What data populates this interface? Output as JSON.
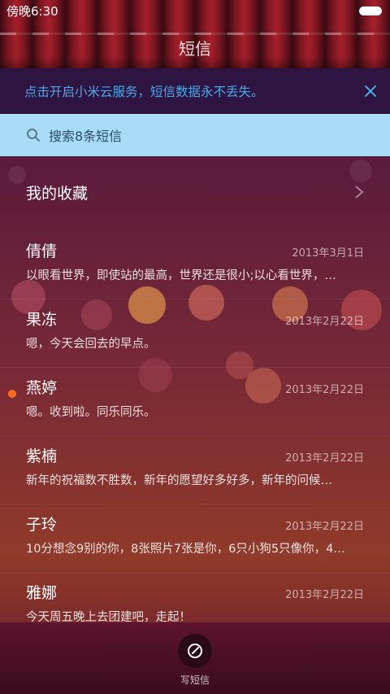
{
  "status_bar": {
    "time": "傍晚6:30"
  },
  "header": {
    "title": "短信"
  },
  "banner": {
    "text": "点击开启小米云服务，短信数据永不丢失。"
  },
  "search": {
    "placeholder": "搜索8条短信"
  },
  "favorites": {
    "label": "我的收藏"
  },
  "messages": [
    {
      "name": "倩倩",
      "date": "2013年3月1日",
      "preview": "以眼看世界，即使站的最高，世界还是很小;以心看世界，…",
      "unread": false
    },
    {
      "name": "果冻",
      "date": "2013年2月22日",
      "preview": "嗯，今天会回去的早点。",
      "unread": false
    },
    {
      "name": "燕婷",
      "date": "2013年2月22日",
      "preview": "嗯。收到啦。同乐同乐。",
      "unread": true
    },
    {
      "name": "紫楠",
      "date": "2013年2月22日",
      "preview": "新年的祝福数不胜数，新年的愿望好多好多，新年的问候…",
      "unread": false
    },
    {
      "name": "子玲",
      "date": "2013年2月22日",
      "preview": "10分想念9别的你，8张照片7张是你，6只小狗5只像你，4…",
      "unread": false
    },
    {
      "name": "雅娜",
      "date": "2013年2月22日",
      "preview": "今天周五晚上去团建吧，走起！",
      "unread": false
    }
  ],
  "bottom_bar": {
    "compose_label": "写短信"
  },
  "colors": {
    "banner_text": "#4aa8e8",
    "search_bg": "#a9dcf7",
    "unread_dot": "#ff6a1a"
  }
}
